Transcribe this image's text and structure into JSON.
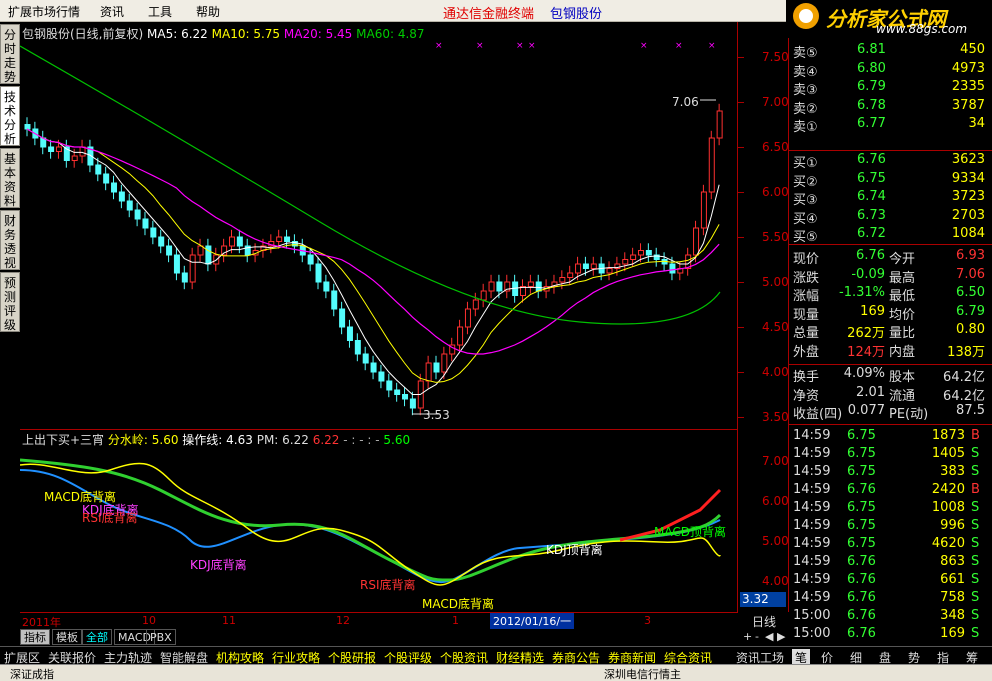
{
  "menu": {
    "items": [
      "扩展市场行情",
      "资讯",
      "工具",
      "帮助"
    ],
    "center_title": "通达信金融终端",
    "stock_title": "包钢股份"
  },
  "logo": {
    "text": "分析家公式网",
    "url": "www.88gs.com"
  },
  "left_tabs": [
    "分时走势",
    "技术分析",
    "基本资料",
    "财务透视",
    "预测评级"
  ],
  "main_chart": {
    "header": "包钢股份(日线,前复权)",
    "ma5": "MA5: 6.22",
    "ma10": "MA10: 5.75",
    "ma20": "MA20: 5.45",
    "ma60": "MA60: 4.87",
    "high_marker": "7.06",
    "low_marker": "3.53",
    "y_ticks": [
      "7.50",
      "7.00",
      "6.50",
      "6.00",
      "5.50",
      "5.00",
      "4.50",
      "4.00",
      "3.50"
    ],
    "colors": {
      "ma5": "#ffffff",
      "ma10": "#ffff00",
      "ma20": "#ff00ff",
      "ma60": "#00c000",
      "up": "#ff3030",
      "down": "#54fcfc"
    }
  },
  "sub_chart": {
    "header": "上出下买+三宵",
    "fen_label": "分水岭: 5.60",
    "op_label": "操作线: 4.63",
    "pm_label": "PM: 6.22",
    "v1": "6.22",
    "dashes": "- : - : -",
    "v2": "5.60",
    "y_ticks": [
      "7.00",
      "6.00",
      "5.00",
      "4.00"
    ],
    "annotations": [
      "MACD底背离",
      "KDJ底背离",
      "RSI底背离",
      "KDJ底背离",
      "RSI底背离",
      "MACD底背离",
      "KDJ顶背离",
      "MACD顶背离"
    ]
  },
  "axis_extra": {
    "current": "3.32",
    "period": "日线"
  },
  "timebar": {
    "labels": [
      "2011年",
      "10",
      "11",
      "12",
      "1",
      "2012/01/16/一",
      "3"
    ]
  },
  "bottom_tabs": [
    "指标",
    "模板",
    "全部",
    "MACD",
    "PBX"
  ],
  "bottom_nav": [
    "扩展区",
    "关联报价",
    "主力轨迹",
    "智能解盘",
    "机构攻略",
    "行业攻略",
    "个股研报",
    "个股评级",
    "个股资讯",
    "财经精选",
    "券商公告",
    "券商新闻",
    "综合资讯",
    "资讯工场"
  ],
  "quote_tabs": [
    "笔",
    "价",
    "细",
    "盘",
    "势",
    "指",
    "筹"
  ],
  "order_book": {
    "sell": [
      {
        "label": "卖⑤",
        "price": "6.81",
        "vol": "450"
      },
      {
        "label": "卖④",
        "price": "6.80",
        "vol": "4973"
      },
      {
        "label": "卖③",
        "price": "6.79",
        "vol": "2335"
      },
      {
        "label": "卖②",
        "price": "6.78",
        "vol": "3787"
      },
      {
        "label": "卖①",
        "price": "6.77",
        "vol": "34"
      }
    ],
    "buy": [
      {
        "label": "买①",
        "price": "6.76",
        "vol": "3623"
      },
      {
        "label": "买②",
        "price": "6.75",
        "vol": "9334"
      },
      {
        "label": "买③",
        "price": "6.74",
        "vol": "3723"
      },
      {
        "label": "买④",
        "price": "6.73",
        "vol": "2703"
      },
      {
        "label": "买⑤",
        "price": "6.72",
        "vol": "1084"
      }
    ]
  },
  "stats": [
    {
      "l1": "现价",
      "v1": "6.76",
      "l2": "今开",
      "v2": "6.93"
    },
    {
      "l1": "涨跌",
      "v1": "-0.09",
      "l2": "最高",
      "v2": "7.06"
    },
    {
      "l1": "涨幅",
      "v1": "-1.31%",
      "l2": "最低",
      "v2": "6.50"
    },
    {
      "l1": "现量",
      "v1": "169",
      "l2": "均价",
      "v2": "6.79"
    },
    {
      "l1": "总量",
      "v1": "262万",
      "l2": "量比",
      "v2": "0.80"
    },
    {
      "l1": "外盘",
      "v1": "124万",
      "l2": "内盘",
      "v2": "138万"
    }
  ],
  "stats2": [
    {
      "l1": "换手",
      "v1": "4.09%",
      "l2": "股本",
      "v2": "64.2亿"
    },
    {
      "l1": "净资",
      "v1": "2.01",
      "l2": "流通",
      "v2": "64.2亿"
    },
    {
      "l1": "收益(四)",
      "v1": "0.077",
      "l2": "PE(动)",
      "v2": "87.5"
    }
  ],
  "ticks": [
    {
      "t": "14:59",
      "p": "6.75",
      "v": "1873",
      "d": "B"
    },
    {
      "t": "14:59",
      "p": "6.75",
      "v": "1405",
      "d": "S"
    },
    {
      "t": "14:59",
      "p": "6.75",
      "v": "383",
      "d": "S"
    },
    {
      "t": "14:59",
      "p": "6.76",
      "v": "2420",
      "d": "B"
    },
    {
      "t": "14:59",
      "p": "6.75",
      "v": "1008",
      "d": "S"
    },
    {
      "t": "14:59",
      "p": "6.75",
      "v": "996",
      "d": "S"
    },
    {
      "t": "14:59",
      "p": "6.75",
      "v": "4620",
      "d": "S"
    },
    {
      "t": "14:59",
      "p": "6.76",
      "v": "863",
      "d": "S"
    },
    {
      "t": "14:59",
      "p": "6.76",
      "v": "661",
      "d": "S"
    },
    {
      "t": "14:59",
      "p": "6.76",
      "v": "758",
      "d": "S"
    },
    {
      "t": "15:00",
      "p": "6.76",
      "v": "348",
      "d": "S"
    },
    {
      "t": "15:00",
      "p": "6.76",
      "v": "169",
      "d": "S"
    }
  ],
  "status": {
    "text1": "深证成指",
    "text2": "深圳电信行情主"
  }
}
